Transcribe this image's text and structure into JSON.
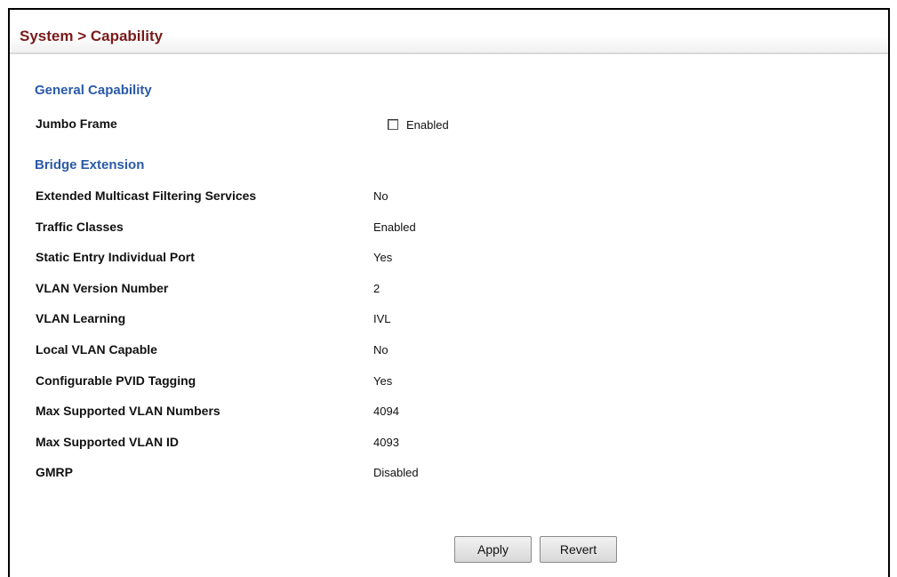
{
  "header": {
    "title": "System > Capability"
  },
  "general": {
    "heading": "General Capability",
    "jumbo_frame": {
      "label": "Jumbo Frame",
      "checkbox_label": "Enabled",
      "checked": false
    }
  },
  "bridge": {
    "heading": "Bridge Extension",
    "rows": [
      {
        "label": "Extended Multicast Filtering Services",
        "value": "No"
      },
      {
        "label": "Traffic Classes",
        "value": "Enabled"
      },
      {
        "label": "Static Entry Individual Port",
        "value": "Yes"
      },
      {
        "label": "VLAN Version Number",
        "value": "2"
      },
      {
        "label": "VLAN Learning",
        "value": "IVL"
      },
      {
        "label": "Local VLAN Capable",
        "value": "No"
      },
      {
        "label": "Configurable PVID Tagging",
        "value": "Yes"
      },
      {
        "label": "Max Supported VLAN Numbers",
        "value": "4094"
      },
      {
        "label": "Max Supported VLAN ID",
        "value": "4093"
      },
      {
        "label": "GMRP",
        "value": "Disabled"
      }
    ]
  },
  "buttons": {
    "apply": "Apply",
    "revert": "Revert"
  }
}
